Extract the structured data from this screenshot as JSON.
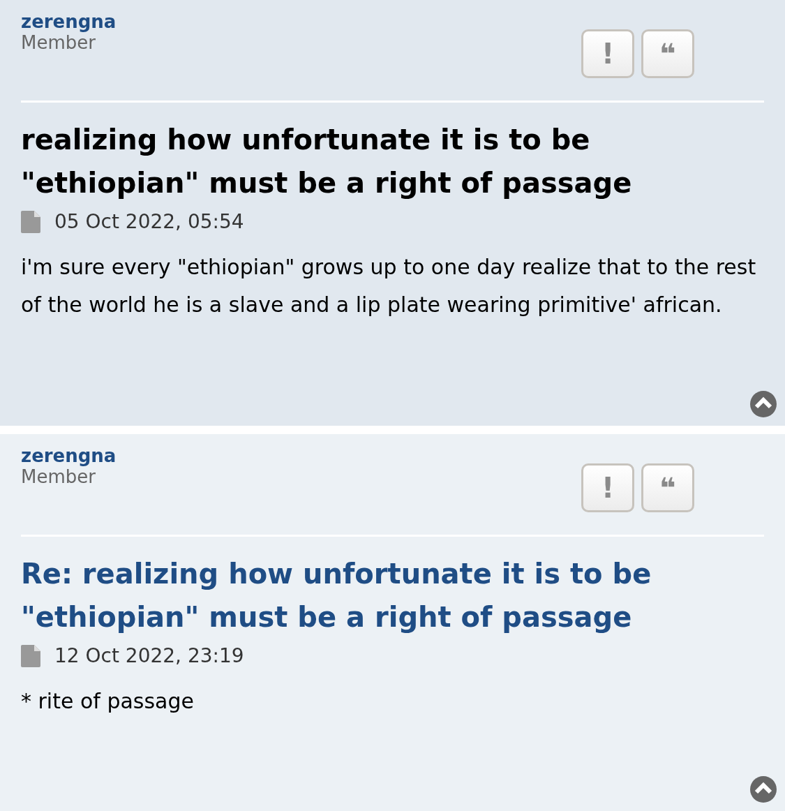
{
  "posts": [
    {
      "kind": "topic",
      "author": "zerengna",
      "rank": "Member",
      "buttons": [
        "!",
        "❝"
      ],
      "title": "realizing how unfortunate it is to be \"ethiopian\" must be a right of passage",
      "date": "05 Oct 2022, 05:54",
      "body": "i'm sure every \"ethiopian\" grows up to one day realize that to the rest of the world he is a slave and a lip plate wearing primitive' african."
    },
    {
      "kind": "reply",
      "author": "zerengna",
      "rank": "Member",
      "buttons": [
        "!",
        "❝"
      ],
      "title": "Re: realizing how unfortunate it is to be \"ethiopian\" must be a right of passage",
      "date": "12 Oct 2022, 23:19",
      "body": "* rite of passage"
    }
  ]
}
